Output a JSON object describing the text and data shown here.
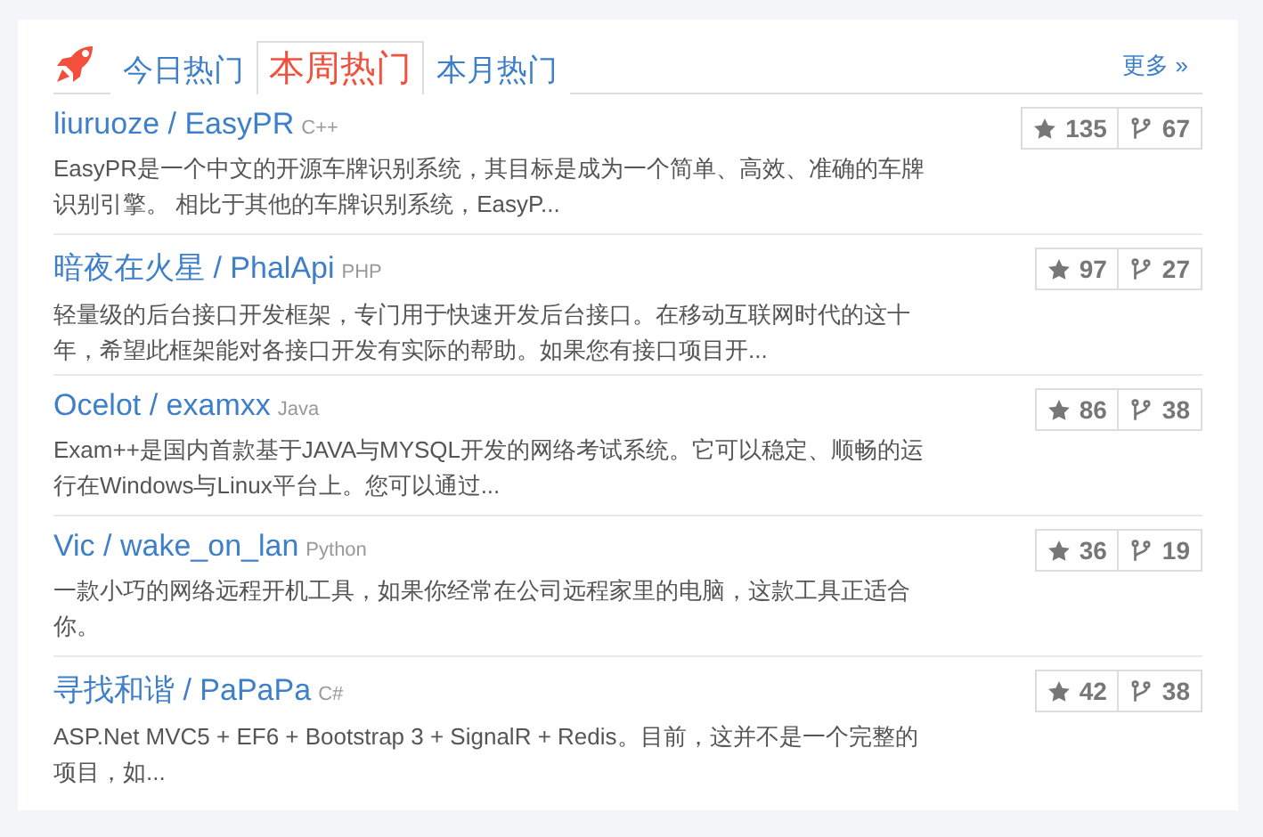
{
  "tabs": [
    {
      "label": "今日热门",
      "selected": false
    },
    {
      "label": "本周热门",
      "selected": true
    },
    {
      "label": "本月热门",
      "selected": false
    }
  ],
  "more_link": "更多 »",
  "projects": [
    {
      "title": "liuruoze / EasyPR",
      "language": "C++",
      "description": "EasyPR是一个中文的开源车牌识别系统，其目标是成为一个简单、高效、准确的车牌识别引擎。 相比于其他的车牌识别系统，EasyP...",
      "star_count": "135",
      "fork_count": "67"
    },
    {
      "title": "暗夜在火星 / PhalApi",
      "language": "PHP",
      "description": "轻量级的后台接口开发框架，专门用于快速开发后台接口。在移动互联网时代的这十年，希望此框架能对各接口开发有实际的帮助。如果您有接口项目开...",
      "star_count": "97",
      "fork_count": "27"
    },
    {
      "title": "Ocelot / examxx",
      "language": "Java",
      "description": "Exam++是国内首款基于JAVA与MYSQL开发的网络考试系统。它可以稳定、顺畅的运行在Windows与Linux平台上。您可以通过...",
      "star_count": "86",
      "fork_count": "38"
    },
    {
      "title": "Vic / wake_on_lan",
      "language": "Python",
      "description": "一款小巧的网络远程开机工具，如果你经常在公司远程家里的电脑，这款工具正适合你。",
      "star_count": "36",
      "fork_count": "19"
    },
    {
      "title": "寻找和谐 / PaPaPa",
      "language": "C#",
      "description": "ASP.Net MVC5 + EF6 + Bootstrap 3 + SignalR + Redis。目前，这并不是一个完整的项目，如...",
      "star_count": "42",
      "fork_count": "38"
    }
  ]
}
